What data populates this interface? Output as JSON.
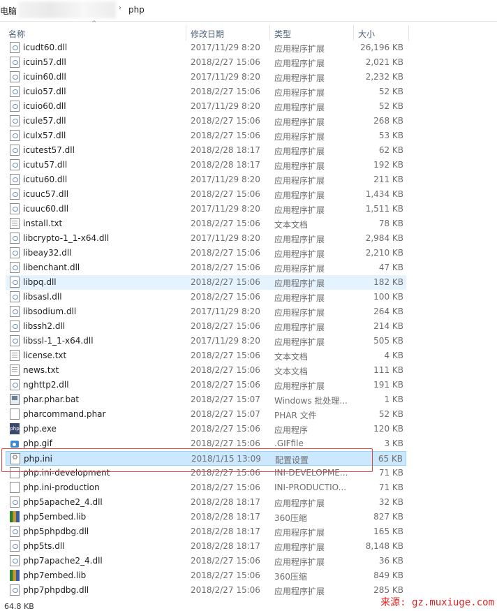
{
  "address": {
    "prev_segment": "电脑",
    "current_segment": "php"
  },
  "columns": {
    "name": "名称",
    "date": "修改日期",
    "type": "类型",
    "size": "大小"
  },
  "files": [
    {
      "name": "icudt60.dll",
      "date": "2017/11/29 8:20",
      "type": "应用程序扩展",
      "size": "26,196 KB",
      "icon": "dll-file-icon"
    },
    {
      "name": "icuin57.dll",
      "date": "2018/2/27 15:06",
      "type": "应用程序扩展",
      "size": "2,021 KB",
      "icon": "dll-file-icon"
    },
    {
      "name": "icuin60.dll",
      "date": "2017/11/29 8:20",
      "type": "应用程序扩展",
      "size": "2,232 KB",
      "icon": "dll-file-icon"
    },
    {
      "name": "icuio57.dll",
      "date": "2018/2/27 15:06",
      "type": "应用程序扩展",
      "size": "52 KB",
      "icon": "dll-file-icon"
    },
    {
      "name": "icuio60.dll",
      "date": "2017/11/29 8:20",
      "type": "应用程序扩展",
      "size": "52 KB",
      "icon": "dll-file-icon"
    },
    {
      "name": "icule57.dll",
      "date": "2018/2/27 15:06",
      "type": "应用程序扩展",
      "size": "268 KB",
      "icon": "dll-file-icon"
    },
    {
      "name": "iculx57.dll",
      "date": "2018/2/27 15:06",
      "type": "应用程序扩展",
      "size": "53 KB",
      "icon": "dll-file-icon"
    },
    {
      "name": "icutest57.dll",
      "date": "2018/2/28 18:17",
      "type": "应用程序扩展",
      "size": "62 KB",
      "icon": "dll-file-icon"
    },
    {
      "name": "icutu57.dll",
      "date": "2018/2/28 18:17",
      "type": "应用程序扩展",
      "size": "192 KB",
      "icon": "dll-file-icon"
    },
    {
      "name": "icutu60.dll",
      "date": "2017/11/29 8:20",
      "type": "应用程序扩展",
      "size": "211 KB",
      "icon": "dll-file-icon"
    },
    {
      "name": "icuuc57.dll",
      "date": "2018/2/27 15:06",
      "type": "应用程序扩展",
      "size": "1,434 KB",
      "icon": "dll-file-icon"
    },
    {
      "name": "icuuc60.dll",
      "date": "2017/11/29 8:20",
      "type": "应用程序扩展",
      "size": "1,511 KB",
      "icon": "dll-file-icon"
    },
    {
      "name": "install.txt",
      "date": "2018/2/27 15:06",
      "type": "文本文档",
      "size": "78 KB",
      "icon": "text-file-icon"
    },
    {
      "name": "libcrypto-1_1-x64.dll",
      "date": "2017/11/29 8:20",
      "type": "应用程序扩展",
      "size": "2,984 KB",
      "icon": "dll-file-icon"
    },
    {
      "name": "libeay32.dll",
      "date": "2018/2/27 15:06",
      "type": "应用程序扩展",
      "size": "2,210 KB",
      "icon": "dll-file-icon"
    },
    {
      "name": "libenchant.dll",
      "date": "2018/2/27 15:06",
      "type": "应用程序扩展",
      "size": "47 KB",
      "icon": "dll-file-icon"
    },
    {
      "name": "libpq.dll",
      "date": "2018/2/27 15:06",
      "type": "应用程序扩展",
      "size": "182 KB",
      "icon": "dll-file-icon",
      "state": "hover"
    },
    {
      "name": "libsasl.dll",
      "date": "2018/2/27 15:06",
      "type": "应用程序扩展",
      "size": "100 KB",
      "icon": "dll-file-icon"
    },
    {
      "name": "libsodium.dll",
      "date": "2017/11/29 8:20",
      "type": "应用程序扩展",
      "size": "264 KB",
      "icon": "dll-file-icon"
    },
    {
      "name": "libssh2.dll",
      "date": "2018/2/27 15:06",
      "type": "应用程序扩展",
      "size": "214 KB",
      "icon": "dll-file-icon"
    },
    {
      "name": "libssl-1_1-x64.dll",
      "date": "2017/11/29 8:20",
      "type": "应用程序扩展",
      "size": "505 KB",
      "icon": "dll-file-icon"
    },
    {
      "name": "license.txt",
      "date": "2018/2/27 15:06",
      "type": "文本文档",
      "size": "4 KB",
      "icon": "text-file-icon"
    },
    {
      "name": "news.txt",
      "date": "2018/2/27 15:06",
      "type": "文本文档",
      "size": "111 KB",
      "icon": "text-file-icon"
    },
    {
      "name": "nghttp2.dll",
      "date": "2018/2/27 15:06",
      "type": "应用程序扩展",
      "size": "191 KB",
      "icon": "dll-file-icon"
    },
    {
      "name": "phar.phar.bat",
      "date": "2018/2/27 15:07",
      "type": "Windows 批处理...",
      "size": "1 KB",
      "icon": "batch-file-icon"
    },
    {
      "name": "pharcommand.phar",
      "date": "2018/2/27 15:07",
      "type": "PHAR 文件",
      "size": "52 KB",
      "icon": "blank-file-icon"
    },
    {
      "name": "php.exe",
      "date": "2018/2/27 15:06",
      "type": "应用程序",
      "size": "120 KB",
      "icon": "php-exe-icon"
    },
    {
      "name": "php.gif",
      "date": "2018/2/27 15:06",
      "type": ".GIFfile",
      "size": "3 KB",
      "icon": "image-file-icon"
    },
    {
      "name": "php.ini",
      "date": "2018/1/15 13:09",
      "type": "配置设置",
      "size": "65 KB",
      "icon": "config-file-icon",
      "state": "selected"
    },
    {
      "name": "php.ini-development",
      "date": "2018/2/27 15:06",
      "type": "INI-DEVELOPME...",
      "size": "71 KB",
      "icon": "blank-file-icon"
    },
    {
      "name": "php.ini-production",
      "date": "2018/2/27 15:06",
      "type": "INI-PRODUCTIO...",
      "size": "71 KB",
      "icon": "blank-file-icon"
    },
    {
      "name": "php5apache2_4.dll",
      "date": "2018/2/28 18:17",
      "type": "应用程序扩展",
      "size": "32 KB",
      "icon": "dll-file-icon"
    },
    {
      "name": "php5embed.lib",
      "date": "2018/2/28 18:17",
      "type": "360压缩",
      "size": "827 KB",
      "icon": "archive-file-icon"
    },
    {
      "name": "php5phpdbg.dll",
      "date": "2018/2/28 18:17",
      "type": "应用程序扩展",
      "size": "165 KB",
      "icon": "dll-file-icon"
    },
    {
      "name": "php5ts.dll",
      "date": "2018/2/28 18:17",
      "type": "应用程序扩展",
      "size": "8,148 KB",
      "icon": "dll-file-icon"
    },
    {
      "name": "php7apache2_4.dll",
      "date": "2018/2/27 15:06",
      "type": "应用程序扩展",
      "size": "36 KB",
      "icon": "dll-file-icon"
    },
    {
      "name": "php7embed.lib",
      "date": "2018/2/27 15:06",
      "type": "360压缩",
      "size": "849 KB",
      "icon": "archive-file-icon"
    },
    {
      "name": "php7phpdbg.dll",
      "date": "2018/2/27 15:06",
      "type": "应用程序扩展",
      "size": "285 KB",
      "icon": "dll-file-icon"
    }
  ],
  "status": {
    "selection_size": "64.8 KB"
  },
  "watermark": "来源: gz.muxiuge.com",
  "colors": {
    "hover": "#e5f3ff",
    "selected": "#cce8ff",
    "highlight_box": "#e0463e"
  }
}
